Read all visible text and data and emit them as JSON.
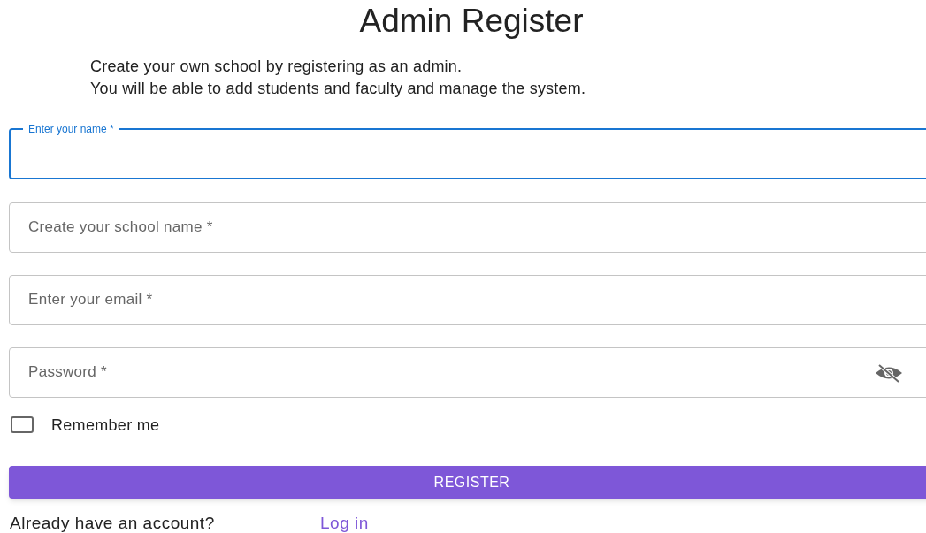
{
  "title": "Admin Register",
  "description": [
    "Create your own school by registering as an admin.",
    "You will be able to add students and faculty and manage the system."
  ],
  "fields": [
    {
      "kind": "text",
      "label": "Enter your name *",
      "focused": true
    },
    {
      "kind": "text",
      "label": "Create your school name *",
      "focused": false
    },
    {
      "kind": "text",
      "label": "Enter your email *",
      "focused": false
    },
    {
      "kind": "password",
      "label": "Password *",
      "focused": false
    }
  ],
  "remember": {
    "label": "Remember me",
    "checked": false
  },
  "button": "REGISTER",
  "footer": {
    "text": "Already have an account?",
    "link": "Log in"
  }
}
